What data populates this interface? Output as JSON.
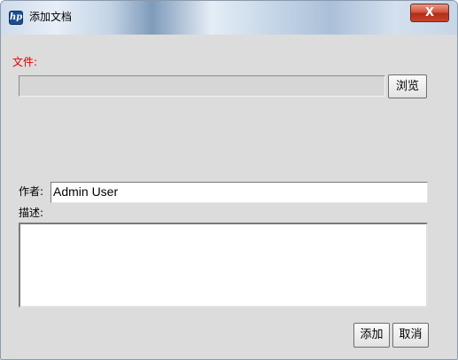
{
  "window": {
    "title": "添加文档",
    "app_icon_glyph": "hp",
    "close_glyph": "X"
  },
  "form": {
    "file_label": "文件:",
    "file_value": "",
    "browse_label": "浏览",
    "author_label": "作者:",
    "author_value": "Admin User",
    "description_label": "描述:",
    "description_value": ""
  },
  "actions": {
    "add_label": "添加",
    "cancel_label": "取消"
  },
  "colors": {
    "required_label": "#e00000",
    "close_button": "#c9432c",
    "app_icon": "#1d4f94"
  },
  "icons": {
    "app": "hp-logo-icon",
    "close": "close-icon"
  }
}
